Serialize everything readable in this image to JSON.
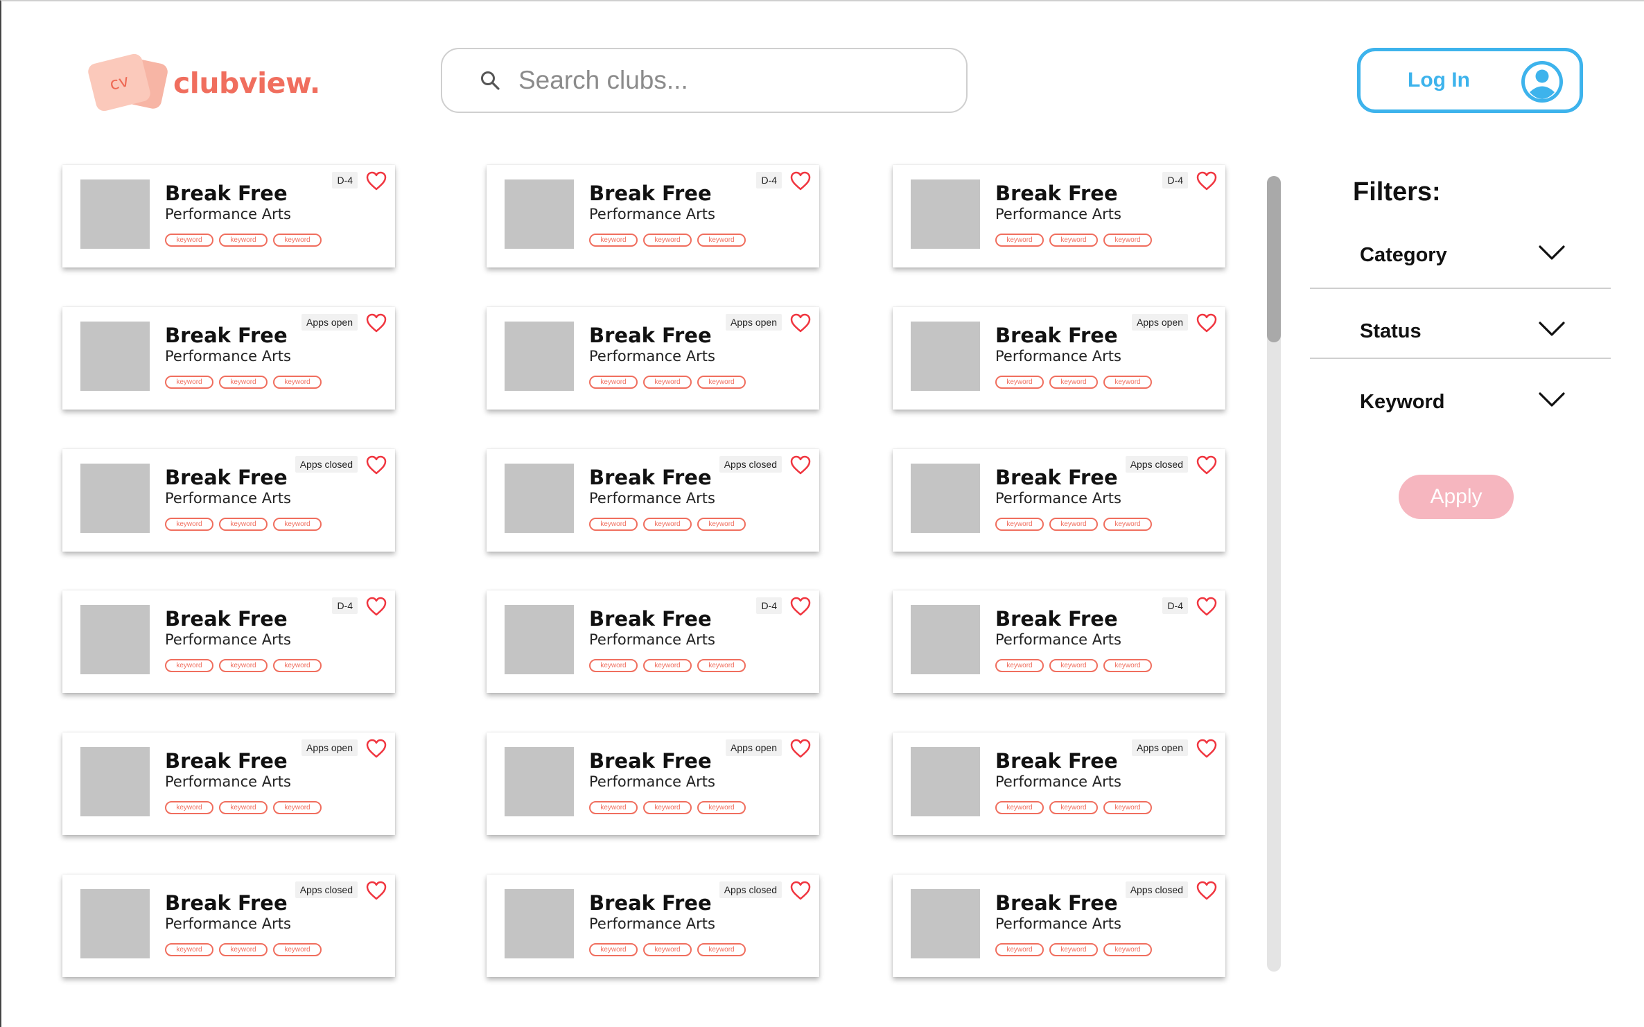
{
  "header": {
    "logo_mark": "cv",
    "logo_text": "clubview.",
    "search_placeholder": "Search clubs...",
    "login_label": "Log In"
  },
  "colors": {
    "brand": "#f06e5e",
    "login_accent": "#3db3ec",
    "apply_disabled": "#f6b6bf",
    "thumbnail": "#c4c4c4"
  },
  "cards": [
    {
      "title": "Break Free",
      "subtitle": "Performance Arts",
      "badge": "D-4",
      "tags": [
        "keyword",
        "keyword",
        "keyword"
      ]
    },
    {
      "title": "Break Free",
      "subtitle": "Performance Arts",
      "badge": "D-4",
      "tags": [
        "keyword",
        "keyword",
        "keyword"
      ]
    },
    {
      "title": "Break Free",
      "subtitle": "Performance Arts",
      "badge": "D-4",
      "tags": [
        "keyword",
        "keyword",
        "keyword"
      ]
    },
    {
      "title": "Break Free",
      "subtitle": "Performance Arts",
      "badge": "Apps open",
      "tags": [
        "keyword",
        "keyword",
        "keyword"
      ]
    },
    {
      "title": "Break Free",
      "subtitle": "Performance Arts",
      "badge": "Apps open",
      "tags": [
        "keyword",
        "keyword",
        "keyword"
      ]
    },
    {
      "title": "Break Free",
      "subtitle": "Performance Arts",
      "badge": "Apps open",
      "tags": [
        "keyword",
        "keyword",
        "keyword"
      ]
    },
    {
      "title": "Break Free",
      "subtitle": "Performance Arts",
      "badge": "Apps closed",
      "tags": [
        "keyword",
        "keyword",
        "keyword"
      ]
    },
    {
      "title": "Break Free",
      "subtitle": "Performance Arts",
      "badge": "Apps closed",
      "tags": [
        "keyword",
        "keyword",
        "keyword"
      ]
    },
    {
      "title": "Break Free",
      "subtitle": "Performance Arts",
      "badge": "Apps closed",
      "tags": [
        "keyword",
        "keyword",
        "keyword"
      ]
    },
    {
      "title": "Break Free",
      "subtitle": "Performance Arts",
      "badge": "D-4",
      "tags": [
        "keyword",
        "keyword",
        "keyword"
      ]
    },
    {
      "title": "Break Free",
      "subtitle": "Performance Arts",
      "badge": "D-4",
      "tags": [
        "keyword",
        "keyword",
        "keyword"
      ]
    },
    {
      "title": "Break Free",
      "subtitle": "Performance Arts",
      "badge": "D-4",
      "tags": [
        "keyword",
        "keyword",
        "keyword"
      ]
    },
    {
      "title": "Break Free",
      "subtitle": "Performance Arts",
      "badge": "Apps open",
      "tags": [
        "keyword",
        "keyword",
        "keyword"
      ]
    },
    {
      "title": "Break Free",
      "subtitle": "Performance Arts",
      "badge": "Apps open",
      "tags": [
        "keyword",
        "keyword",
        "keyword"
      ]
    },
    {
      "title": "Break Free",
      "subtitle": "Performance Arts",
      "badge": "Apps open",
      "tags": [
        "keyword",
        "keyword",
        "keyword"
      ]
    },
    {
      "title": "Break Free",
      "subtitle": "Performance Arts",
      "badge": "Apps closed",
      "tags": [
        "keyword",
        "keyword",
        "keyword"
      ]
    },
    {
      "title": "Break Free",
      "subtitle": "Performance Arts",
      "badge": "Apps closed",
      "tags": [
        "keyword",
        "keyword",
        "keyword"
      ]
    },
    {
      "title": "Break Free",
      "subtitle": "Performance Arts",
      "badge": "Apps closed",
      "tags": [
        "keyword",
        "keyword",
        "keyword"
      ]
    }
  ],
  "filters": {
    "title": "Filters:",
    "items": [
      {
        "label": "Category",
        "icon": "chevron-down-icon"
      },
      {
        "label": "Status",
        "icon": "chevron-down-icon"
      },
      {
        "label": "Keyword",
        "icon": "chevron-down-icon"
      }
    ],
    "apply_label": "Apply"
  }
}
